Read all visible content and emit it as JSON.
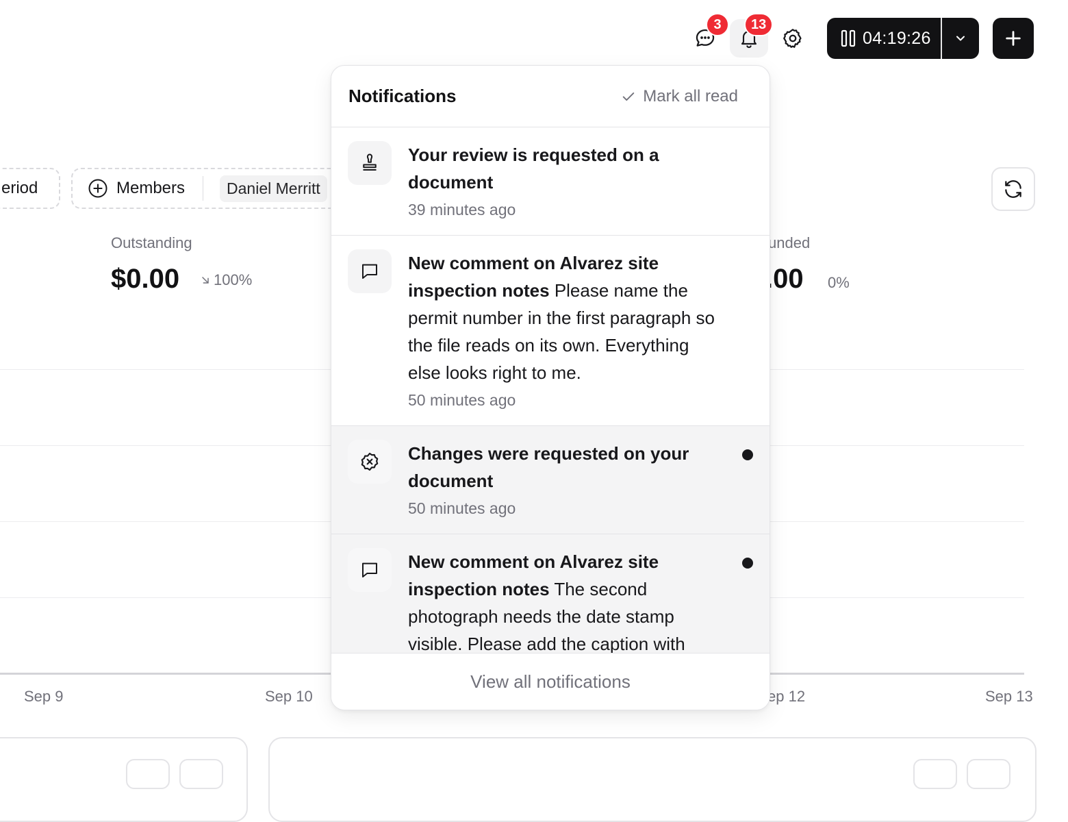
{
  "header": {
    "chat_badge": "3",
    "notification_badge": "13",
    "timer": "04:19:26"
  },
  "filters": {
    "period_label": "eriod",
    "members_label": "Members",
    "member_name": "Daniel Merritt"
  },
  "stats": {
    "outstanding": {
      "label": "Outstanding",
      "value": "$0.00",
      "change": "100%"
    },
    "refunded": {
      "label": "unded",
      "value": ".00",
      "change": "0%"
    }
  },
  "chart": {
    "ticks": [
      "Sep 9",
      "Sep 10",
      "ep 12",
      "Sep 13"
    ]
  },
  "notifications": {
    "title": "Notifications",
    "mark_all_read": "Mark all read",
    "view_all": "View all notifications",
    "items": [
      {
        "icon": "stamp-icon",
        "title": "Your review is requested on a document",
        "message": "",
        "time": "39 minutes ago",
        "unread": false
      },
      {
        "icon": "comment-icon",
        "title": "New comment on Alvarez site inspection notes",
        "message": "Please name the permit number in the first paragraph so the file reads on its own. Everything else looks right to me.",
        "time": "50 minutes ago",
        "unread": false
      },
      {
        "icon": "x-badge-icon",
        "title": "Changes were requested on your document",
        "message": "",
        "time": "50 minutes ago",
        "unread": true
      },
      {
        "icon": "comment-icon",
        "title": "New comment on Alvarez site inspection notes",
        "message": "The second photograph needs the date stamp visible. Please add the caption with",
        "time": "",
        "unread": true
      }
    ]
  }
}
